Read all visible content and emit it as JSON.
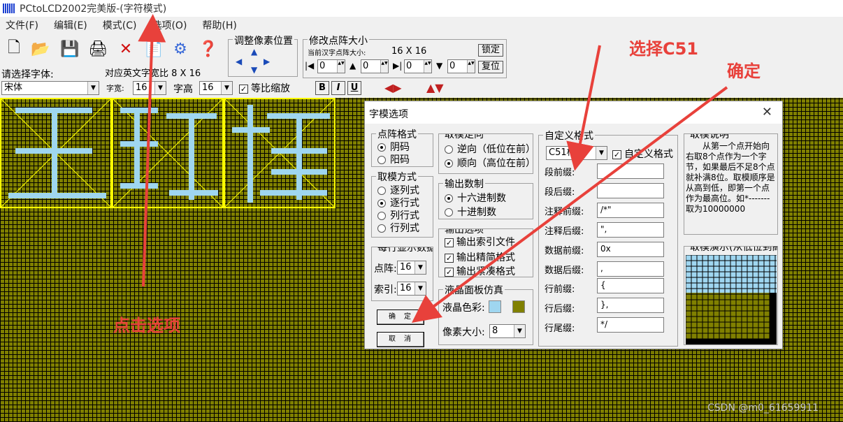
{
  "window": {
    "title": "PCtoLCD2002完美版-(字符模式)"
  },
  "menu": {
    "items": [
      "文件(F)",
      "编辑(E)",
      "模式(C)",
      "选项(O)",
      "帮助(H)"
    ]
  },
  "toolbar": {
    "font_prompt": "请选择字体:",
    "font_value": "宋体",
    "ascii_ratio_label": "对应英文字宽比",
    "ascii_ratio_value": "8 X 16",
    "font_width_label": "字宽:",
    "font_width_value": "16",
    "font_height_label": "字高",
    "font_height_value": "16",
    "proportional_label": "等比缩放",
    "pixel_pos_title": "调整像素位置",
    "dot_size_title": "修改点阵大小",
    "current_size_label": "当前汉字点阵大小:",
    "current_size_value": "16 X 16",
    "lock_label": "锁定",
    "reset_label": "复位",
    "spin_values": [
      "0",
      "0",
      "0",
      "0"
    ],
    "style_bold": "B",
    "style_italic": "I",
    "style_underline": "U"
  },
  "dialog": {
    "title": "字模选项",
    "close": "✕",
    "dot_format": {
      "title": "点阵格式",
      "options": [
        "阴码",
        "阳码"
      ],
      "selected": 0
    },
    "mode": {
      "title": "取模方式",
      "options": [
        "逐列式",
        "逐行式",
        "列行式",
        "行列式"
      ],
      "selected": 1
    },
    "per_line": {
      "title": "每行显示数据",
      "dot_label": "点阵:",
      "dot_value": "16",
      "index_label": "索引:",
      "index_value": "16"
    },
    "direction": {
      "title": "取模走向",
      "options": [
        "逆向（低位在前）",
        "顺向（高位在前）"
      ],
      "selected": 1
    },
    "radix": {
      "title": "输出数制",
      "options": [
        "十六进制数",
        "十进制数"
      ],
      "selected": 0
    },
    "output": {
      "title": "输出选项",
      "options": [
        "输出索引文件",
        "输出精简格式",
        "输出紧凑格式"
      ]
    },
    "lcd": {
      "title": "液晶面板仿真",
      "color_label": "液晶色彩:",
      "pixel_label": "像素大小:",
      "pixel_value": "8",
      "color_on": "#9fd6f0",
      "color_bg": "#808000"
    },
    "custom": {
      "title": "自定义格式",
      "format_value": "C51格式",
      "custom_check": "自定义格式",
      "fields": [
        {
          "label": "段前缀:",
          "value": ""
        },
        {
          "label": "段后缀:",
          "value": ""
        },
        {
          "label": "注释前缀:",
          "value": "/*\""
        },
        {
          "label": "注释后缀:",
          "value": "\","
        },
        {
          "label": "数据前缀:",
          "value": "0x"
        },
        {
          "label": "数据后缀:",
          "value": ","
        },
        {
          "label": "行前缀:",
          "value": "{"
        },
        {
          "label": "行后缀:",
          "value": "},"
        },
        {
          "label": "行尾缀:",
          "value": "*/"
        }
      ]
    },
    "explain": {
      "title": "取模说明",
      "text": "从第一个点开始向右取8个点作为一个字节，如果最后不足8个点就补满8位。取模顺序是从高到低，即第一个点作为最高位。如*-------取为10000000"
    },
    "demo": {
      "title": "取模演示(从低位到高位)"
    },
    "ok": "确定",
    "cancel": "取消"
  },
  "annotations": {
    "click_option": "点击选项",
    "select_c51": "选择C51",
    "confirm": "确定"
  },
  "watermark": "CSDN @m0_61659911"
}
